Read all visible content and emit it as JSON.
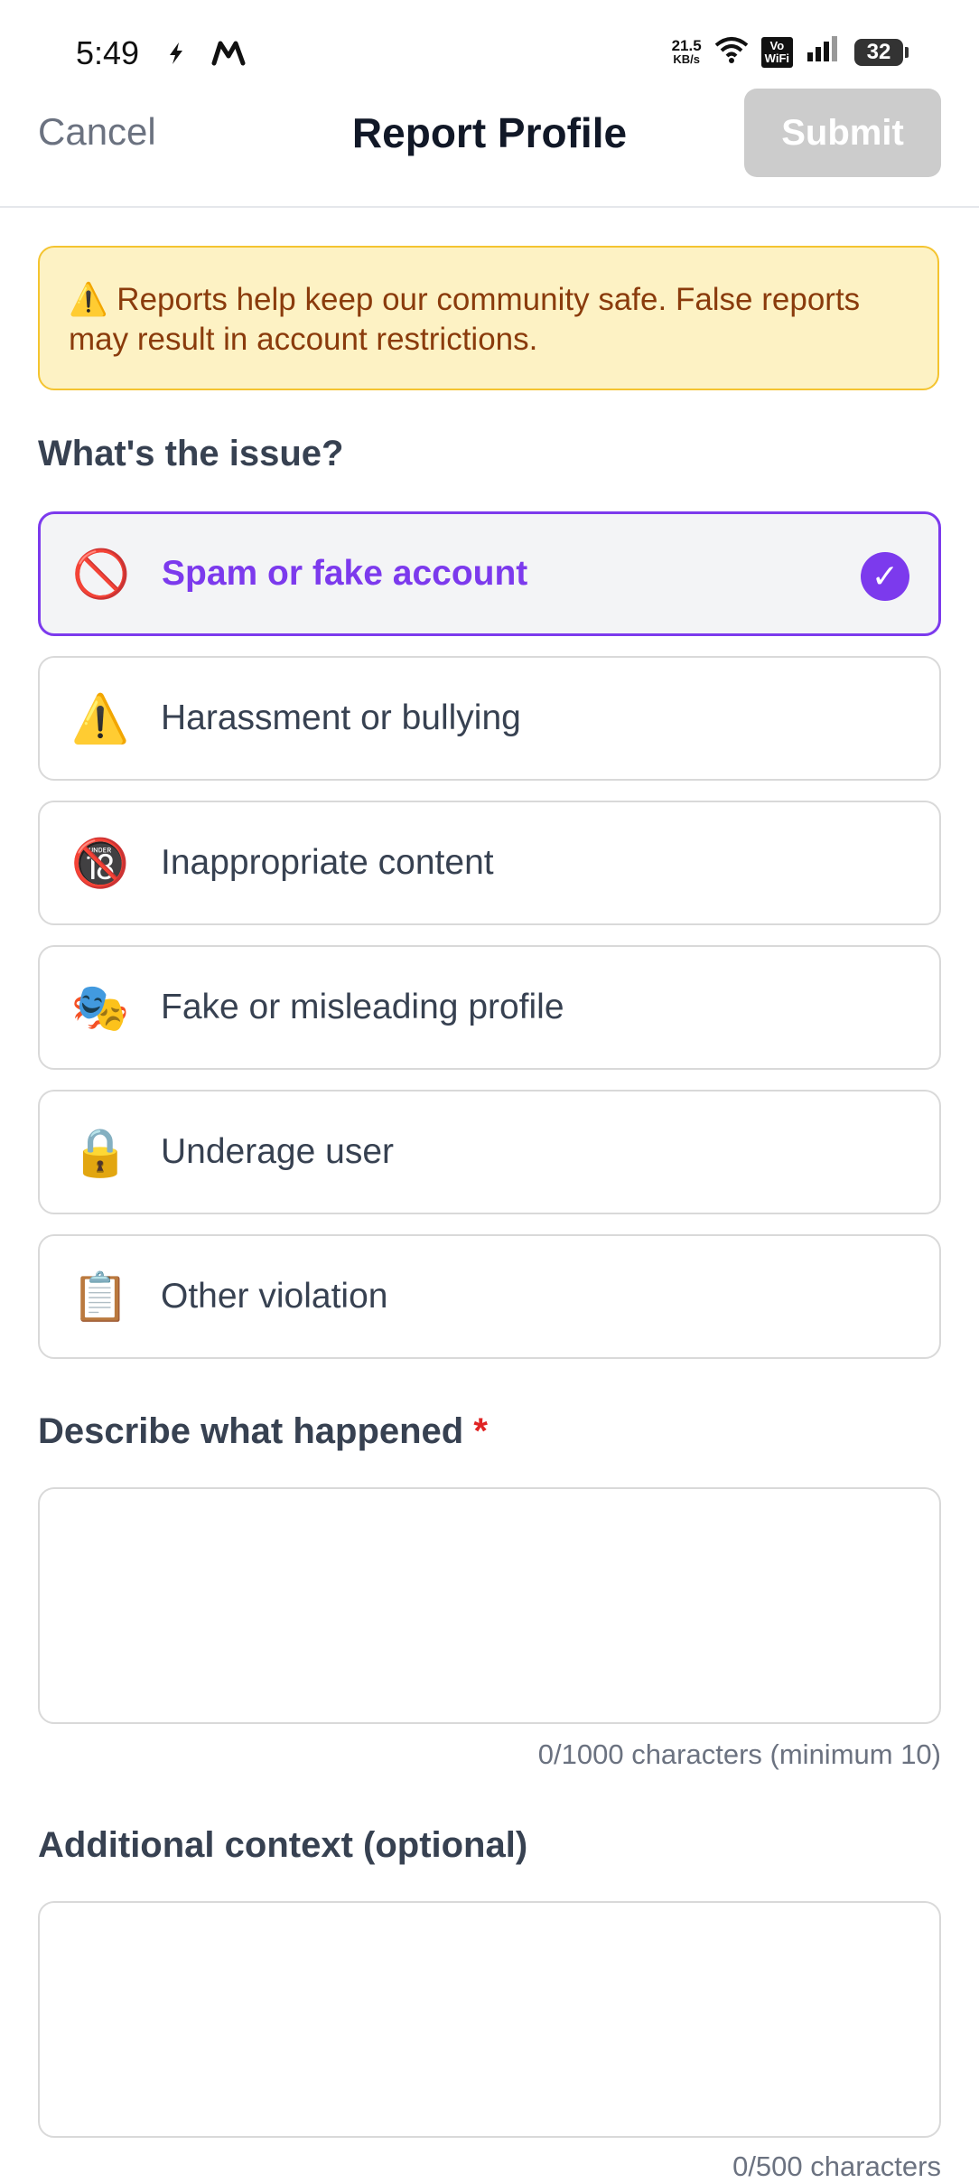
{
  "status_bar": {
    "time": "5:49",
    "speed_value": "21.5",
    "speed_unit": "KB/s",
    "vowifi_top": "Vo",
    "vowifi_bottom": "WiFi",
    "battery": "32"
  },
  "header": {
    "cancel_label": "Cancel",
    "title": "Report Profile",
    "submit_label": "Submit"
  },
  "warning": {
    "text": "⚠️ Reports help keep our community safe. False reports may result in account restrictions."
  },
  "issue_section": {
    "label": "What's the issue?",
    "options": [
      {
        "icon": "🚫",
        "label": "Spam or fake account",
        "selected": true
      },
      {
        "icon": "⚠️",
        "label": "Harassment or bullying",
        "selected": false
      },
      {
        "icon": "🔞",
        "label": "Inappropriate content",
        "selected": false
      },
      {
        "icon": "🎭",
        "label": "Fake or misleading profile",
        "selected": false
      },
      {
        "icon": "🔒",
        "label": "Underage user",
        "selected": false
      },
      {
        "icon": "📋",
        "label": "Other violation",
        "selected": false
      }
    ],
    "check_mark": "✓"
  },
  "description": {
    "label": "Describe what happened",
    "required_mark": "*",
    "value": "",
    "counter": "0/1000 characters (minimum 10)"
  },
  "context": {
    "label": "Additional context (optional)",
    "value": "",
    "counter": "0/500 characters"
  },
  "colors": {
    "accent": "#7c3aed",
    "warning_bg": "#fdf2c4",
    "warning_border": "#f4c430",
    "warning_text": "#8a3b0c",
    "submit_disabled": "#cccccc"
  }
}
